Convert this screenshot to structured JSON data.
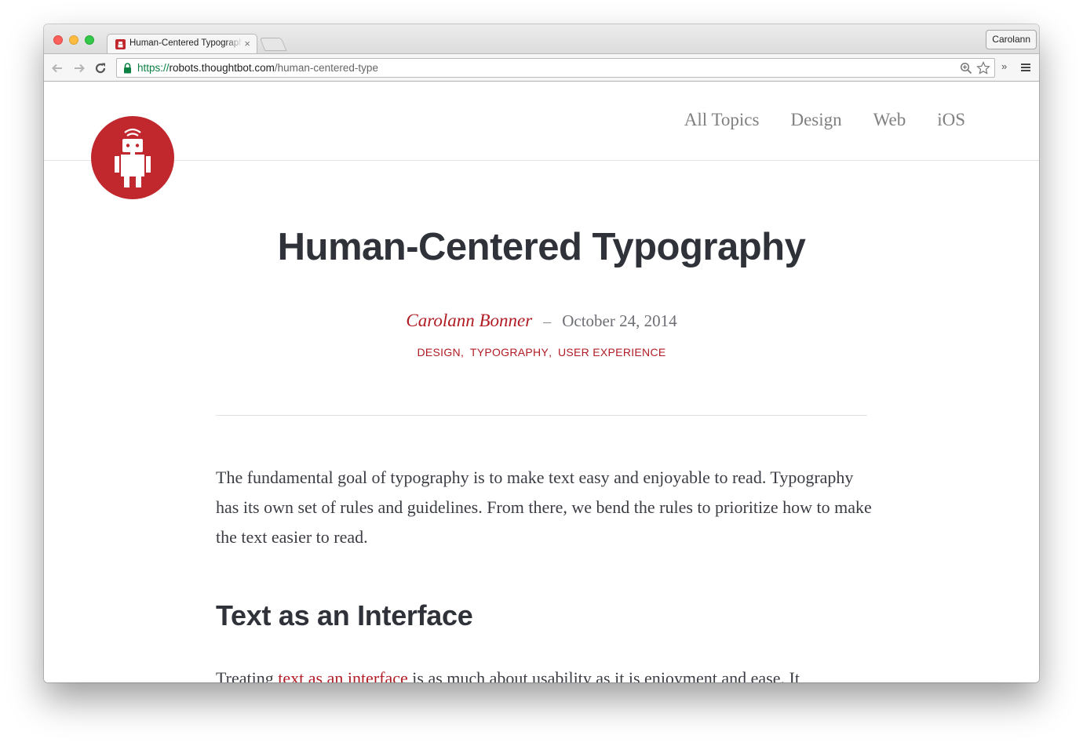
{
  "browser": {
    "tab_title": "Human-Centered Typography | thoughtbot",
    "tab_close": "×",
    "profile_name": "Carolann",
    "url_scheme": "https://",
    "url_host": "robots.thoughtbot.com",
    "url_path": "/human-centered-type",
    "extensions_label": "»"
  },
  "site": {
    "nav": [
      "All Topics",
      "Design",
      "Web",
      "iOS"
    ],
    "brand_color": "#c1282e"
  },
  "article": {
    "title": "Human-Centered Typography",
    "author": "Carolann Bonner",
    "separator": "–",
    "date": "October 24, 2014",
    "tags": [
      "DESIGN",
      "TYPOGRAPHY",
      "USER EXPERIENCE"
    ],
    "tag_separator": ",",
    "paragraph_1": "The fundamental goal of typography is to make text easy and enjoyable to read. Typography has its own set of rules and guidelines. From there, we bend the rules to prioritize how to make the text easier to read.",
    "heading_1": "Text as an Interface",
    "paragraph_2_start": "Treating ",
    "paragraph_2_link": "text as an interface",
    "paragraph_2_end": " is as much about usability as it is enjoyment and ease. It"
  }
}
